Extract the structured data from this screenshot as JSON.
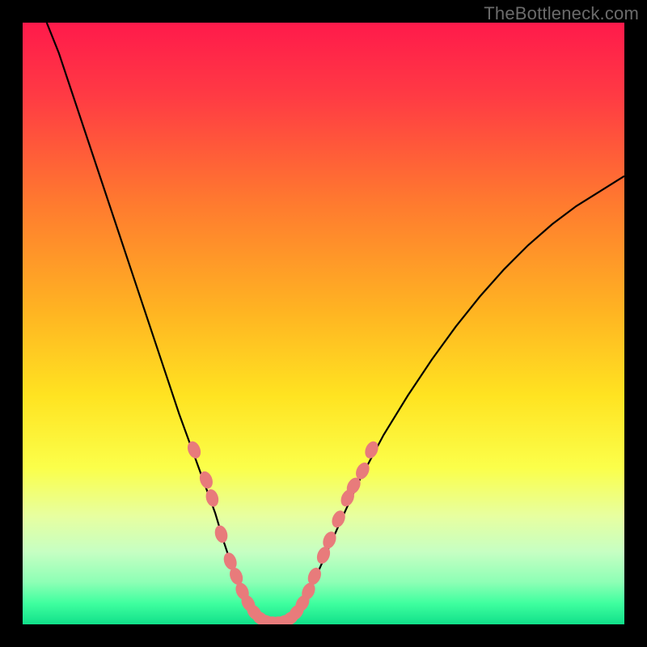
{
  "watermark": "TheBottleneck.com",
  "chart_data": {
    "type": "line",
    "title": "",
    "xlabel": "",
    "ylabel": "",
    "xlim": [
      0,
      100
    ],
    "ylim": [
      0,
      100
    ],
    "gradient_stops": [
      {
        "offset": 0,
        "color": "#ff1a4b"
      },
      {
        "offset": 0.12,
        "color": "#ff3a44"
      },
      {
        "offset": 0.3,
        "color": "#ff7a2f"
      },
      {
        "offset": 0.48,
        "color": "#ffb422"
      },
      {
        "offset": 0.62,
        "color": "#ffe321"
      },
      {
        "offset": 0.74,
        "color": "#fbff4a"
      },
      {
        "offset": 0.82,
        "color": "#e7ffa0"
      },
      {
        "offset": 0.88,
        "color": "#c6ffc3"
      },
      {
        "offset": 0.93,
        "color": "#8dffb5"
      },
      {
        "offset": 0.965,
        "color": "#3fff9f"
      },
      {
        "offset": 1.0,
        "color": "#11e08a"
      }
    ],
    "series": [
      {
        "name": "left-curve",
        "x": [
          4,
          6,
          8,
          10,
          12,
          14,
          16,
          18,
          20,
          22,
          24,
          26,
          28,
          30,
          32,
          33.5,
          35,
          36.5,
          38,
          39
        ],
        "y": [
          100,
          95,
          89,
          83,
          77,
          71,
          65,
          59,
          53,
          47,
          41,
          35,
          29.5,
          24,
          18.5,
          13.5,
          9,
          5,
          2,
          0.5
        ]
      },
      {
        "name": "valley",
        "x": [
          39,
          40,
          41,
          42,
          43,
          44,
          45
        ],
        "y": [
          0.5,
          0.2,
          0.1,
          0.1,
          0.2,
          0.4,
          0.8
        ]
      },
      {
        "name": "right-curve",
        "x": [
          45,
          47,
          49,
          51,
          53,
          56,
          60,
          64,
          68,
          72,
          76,
          80,
          84,
          88,
          92,
          96,
          100
        ],
        "y": [
          0.8,
          4,
          8.5,
          13,
          17.5,
          24,
          31.5,
          38,
          44,
          49.5,
          54.5,
          59,
          63,
          66.5,
          69.5,
          72,
          74.5
        ]
      }
    ],
    "markers": {
      "name": "highlighted-points",
      "color": "#e87b7b",
      "points": [
        {
          "x": 28.5,
          "y": 29
        },
        {
          "x": 30.5,
          "y": 24
        },
        {
          "x": 31.5,
          "y": 21
        },
        {
          "x": 33.0,
          "y": 15
        },
        {
          "x": 34.5,
          "y": 10.5
        },
        {
          "x": 35.5,
          "y": 8
        },
        {
          "x": 36.5,
          "y": 5.5
        },
        {
          "x": 37.5,
          "y": 3.5
        },
        {
          "x": 38.5,
          "y": 2
        },
        {
          "x": 39.5,
          "y": 1
        },
        {
          "x": 40.5,
          "y": 0.5
        },
        {
          "x": 41.5,
          "y": 0.3
        },
        {
          "x": 42.5,
          "y": 0.3
        },
        {
          "x": 43.5,
          "y": 0.5
        },
        {
          "x": 44.5,
          "y": 1
        },
        {
          "x": 45.5,
          "y": 2
        },
        {
          "x": 46.5,
          "y": 3.5
        },
        {
          "x": 47.5,
          "y": 5.5
        },
        {
          "x": 48.5,
          "y": 8
        },
        {
          "x": 50.0,
          "y": 11.5
        },
        {
          "x": 51.0,
          "y": 14
        },
        {
          "x": 52.5,
          "y": 17.5
        },
        {
          "x": 54.0,
          "y": 21
        },
        {
          "x": 55.0,
          "y": 23
        },
        {
          "x": 56.5,
          "y": 25.5
        },
        {
          "x": 58.0,
          "y": 29
        }
      ]
    }
  }
}
